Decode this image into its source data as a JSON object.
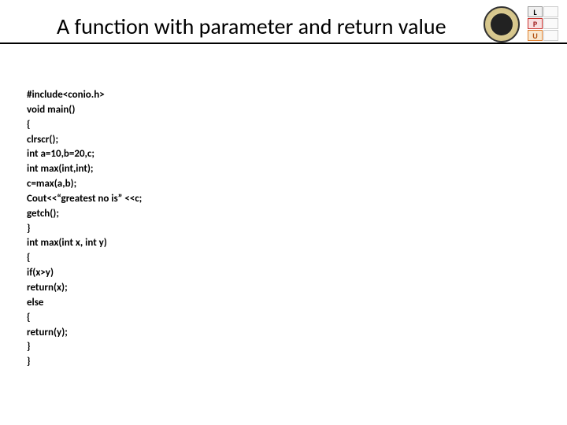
{
  "slide": {
    "title": "A function with parameter and return value"
  },
  "lpu": {
    "l": "L",
    "p": "P",
    "u": "U"
  },
  "code": {
    "lines": [
      "#include<conio.h>",
      "void main()",
      "{",
      "clrscr();",
      "int a=10,b=20,c;",
      "int max(int,int);",
      "c=max(a,b);",
      "Cout<<“greatest no is” <<c;",
      "getch();",
      "}",
      "int max(int x, int y)",
      "{",
      "if(x>y)",
      "return(x);",
      "else",
      "{",
      "return(y);",
      "}",
      "}"
    ]
  }
}
